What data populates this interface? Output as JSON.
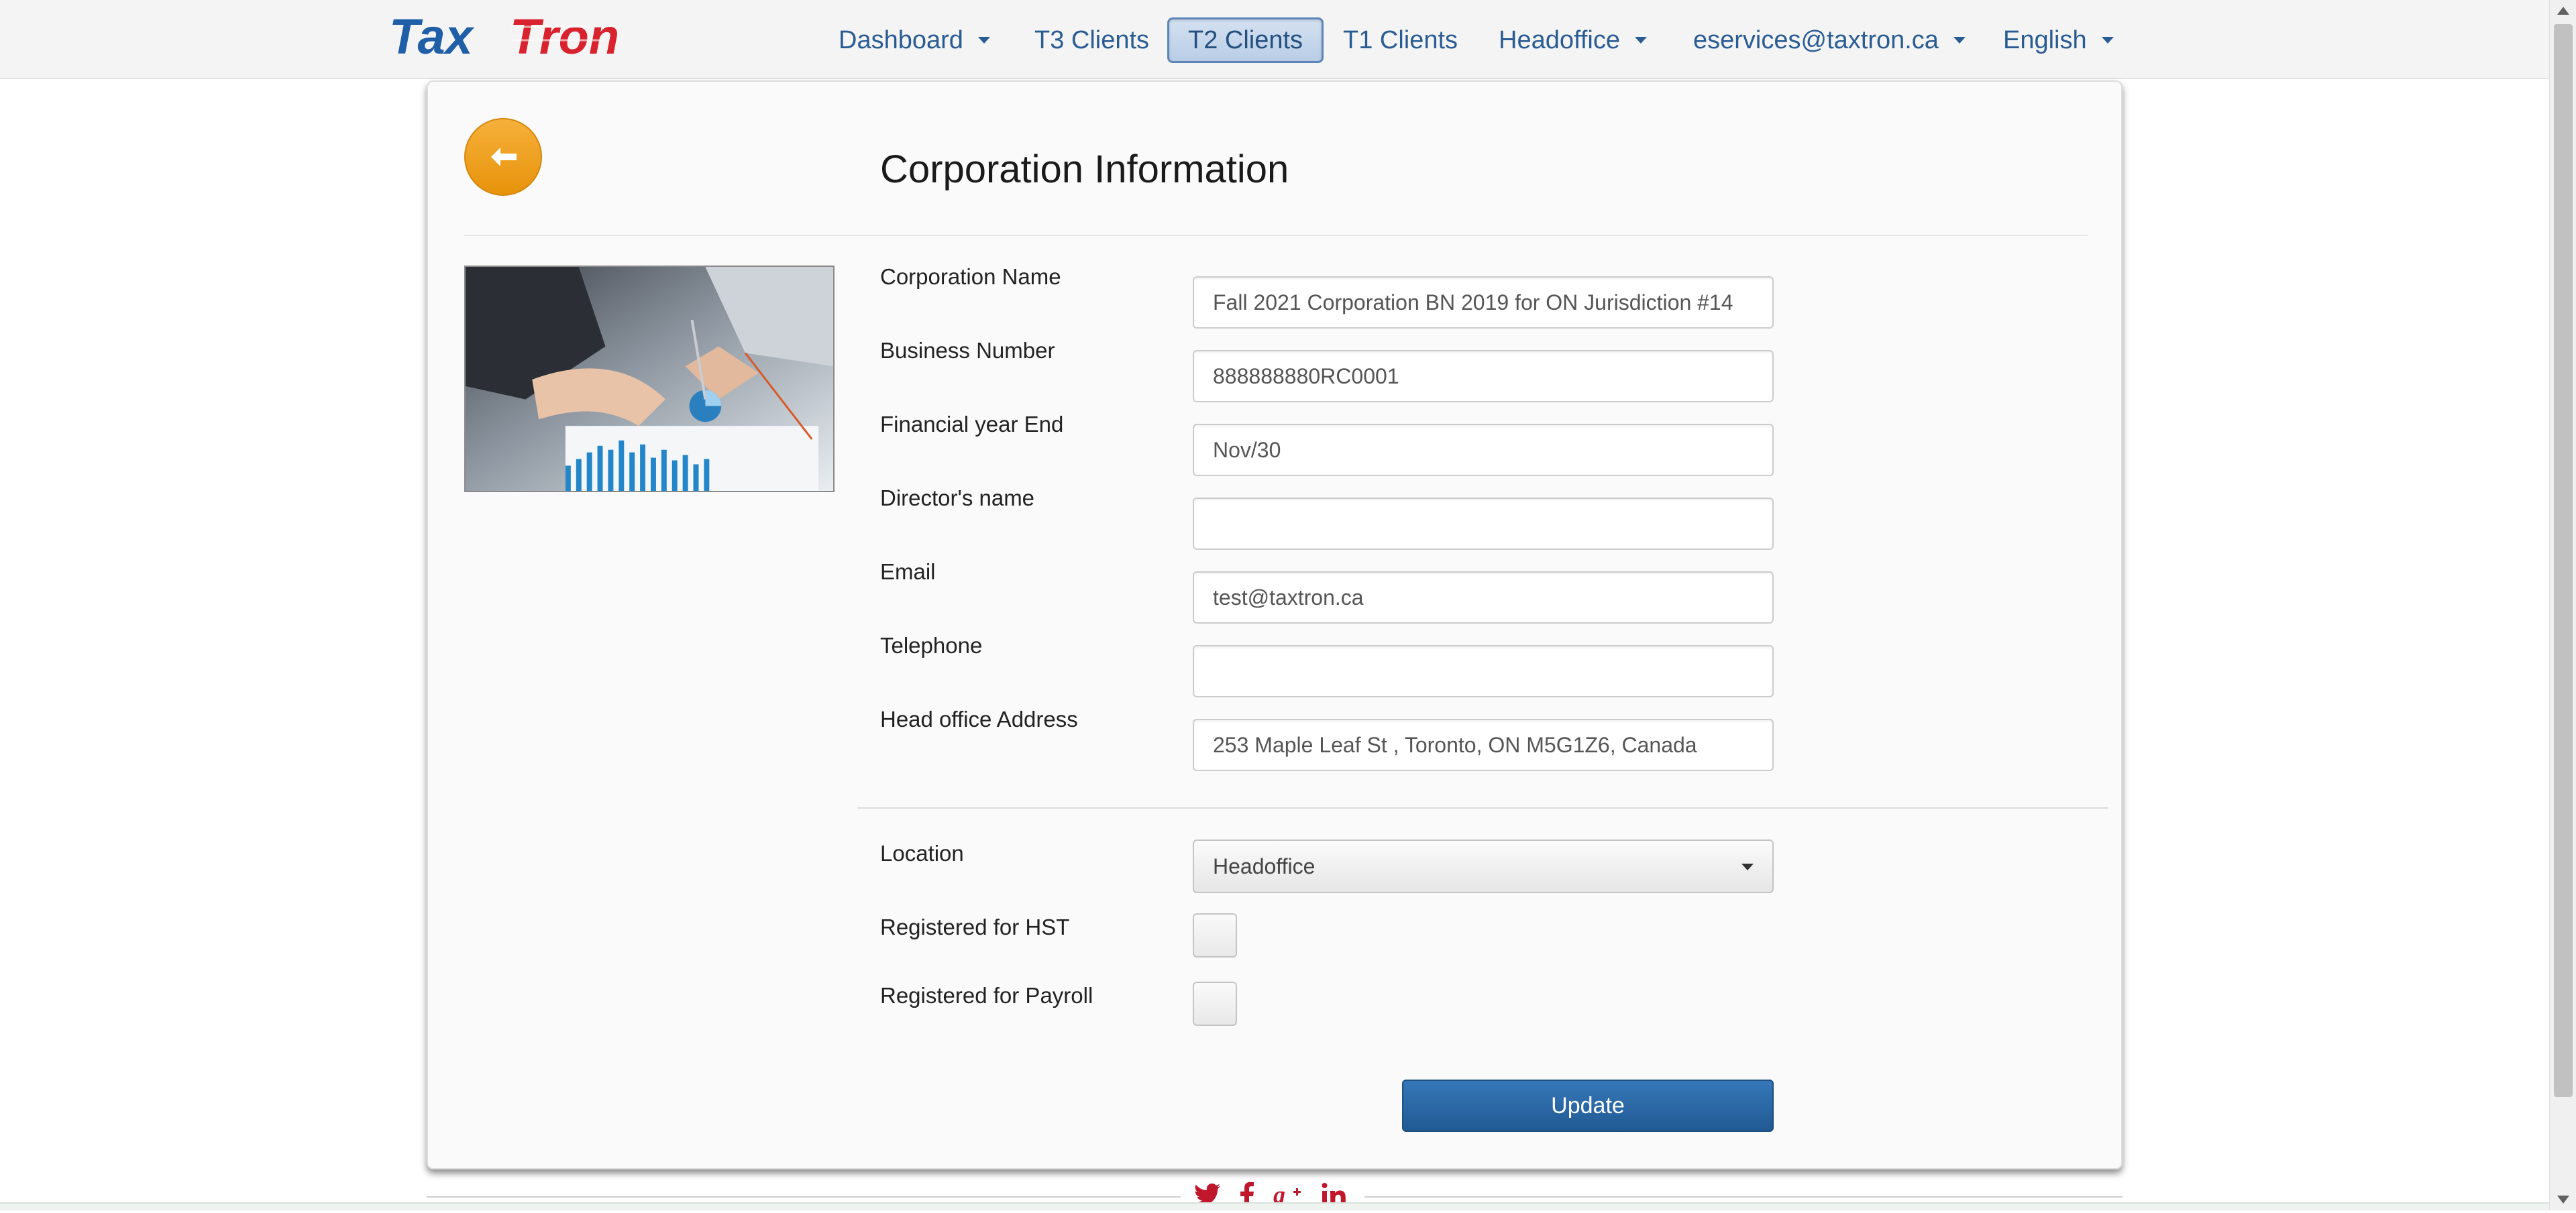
{
  "brand": {
    "logo_text": "TaxTron"
  },
  "nav": {
    "items": [
      {
        "label": "Dashboard",
        "has_caret": true
      },
      {
        "label": "T3 Clients",
        "has_caret": false
      },
      {
        "label": "T2 Clients",
        "has_caret": false,
        "active": true
      },
      {
        "label": "T1 Clients",
        "has_caret": false
      },
      {
        "label": "Headoffice",
        "has_caret": true
      },
      {
        "label": "eservices@taxtron.ca",
        "has_caret": true
      },
      {
        "label": "English",
        "has_caret": true
      }
    ]
  },
  "page": {
    "title": "Corporation Information",
    "back_icon": "arrow-left-icon"
  },
  "form": {
    "fields": [
      {
        "label": "Corporation Name",
        "value": "Fall 2021 Corporation BN 2019 for ON Jurisdiction #14"
      },
      {
        "label": "Business Number",
        "value": "888888880RC0001"
      },
      {
        "label": "Financial year End",
        "value": "Nov/30"
      },
      {
        "label": "Director's name",
        "value": ""
      },
      {
        "label": "Email",
        "value": "test@taxtron.ca"
      },
      {
        "label": "Telephone",
        "value": ""
      },
      {
        "label": "Head office Address",
        "value": "253 Maple Leaf St , Toronto, ON M5G1Z6, Canada"
      }
    ],
    "location": {
      "label": "Location",
      "selected": "Headoffice"
    },
    "hst": {
      "label": "Registered for HST",
      "checked": false
    },
    "payroll": {
      "label": "Registered for Payroll",
      "checked": false
    },
    "update_label": "Update"
  },
  "footer": {
    "social": [
      "twitter-icon",
      "facebook-icon",
      "google-plus-icon",
      "linkedin-icon"
    ]
  },
  "colors": {
    "accent_blue": "#2a5c94",
    "back_button_orange": "#f0a020",
    "update_button_blue": "#2a6aa8",
    "logo_blue": "#1f5fa8",
    "logo_red": "#d8232f"
  }
}
